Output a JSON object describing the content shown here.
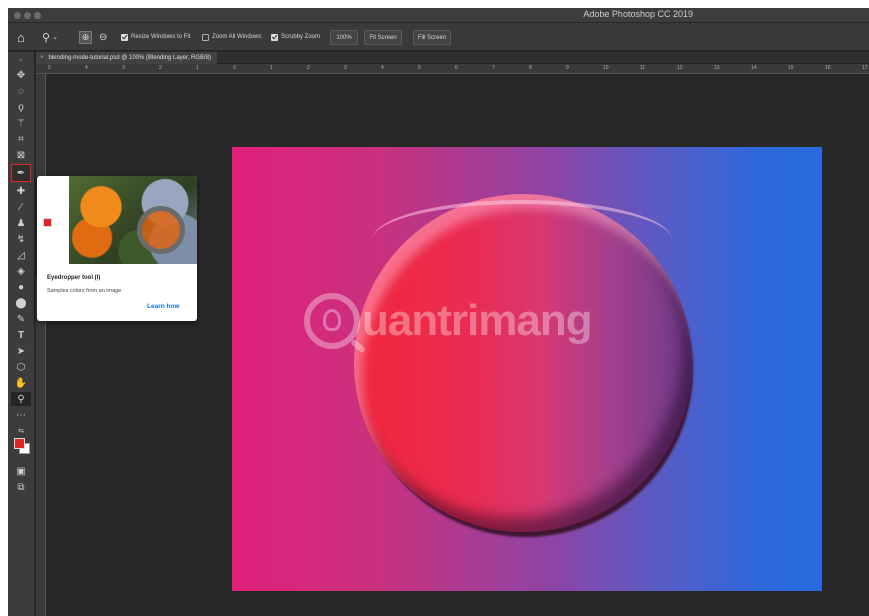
{
  "window": {
    "app_title": "Adobe Photoshop CC 2019"
  },
  "options_bar": {
    "tool_icon": "zoom-icon",
    "resize_windows_label": "Resize Windows to Fit",
    "zoom_all_windows_label": "Zoom All Windows",
    "scrubby_zoom_label": "Scrubby Zoom",
    "zoom_value": "100%",
    "fit_screen_label": "Fit Screen",
    "fill_screen_label": "Fill Screen"
  },
  "document": {
    "tab_label": "blending-mode-tutorial.psd @ 100% (Blending Layer, RGB/8)"
  },
  "ruler": {
    "top_ticks": [
      "5",
      "4",
      "3",
      "2",
      "1",
      "0",
      "1",
      "2",
      "3",
      "4",
      "5",
      "6",
      "7",
      "8",
      "9",
      "10",
      "11",
      "12",
      "13",
      "14",
      "15",
      "16",
      "17"
    ]
  },
  "tooltip": {
    "title": "Eyedropper tool (I)",
    "description": "Samples colors from an image",
    "link": "Learn how"
  },
  "canvas": {
    "watermark": "uantrimang",
    "gradient_colors": [
      "#e0207a",
      "#8b45a6",
      "#2a6ae0"
    ],
    "circle_colors": [
      "#f1263c",
      "#d93872",
      "#6b3b8a"
    ]
  },
  "colors": {
    "foreground": "#e0242a",
    "background": "#ffffff",
    "accent_link": "#1473e6"
  }
}
